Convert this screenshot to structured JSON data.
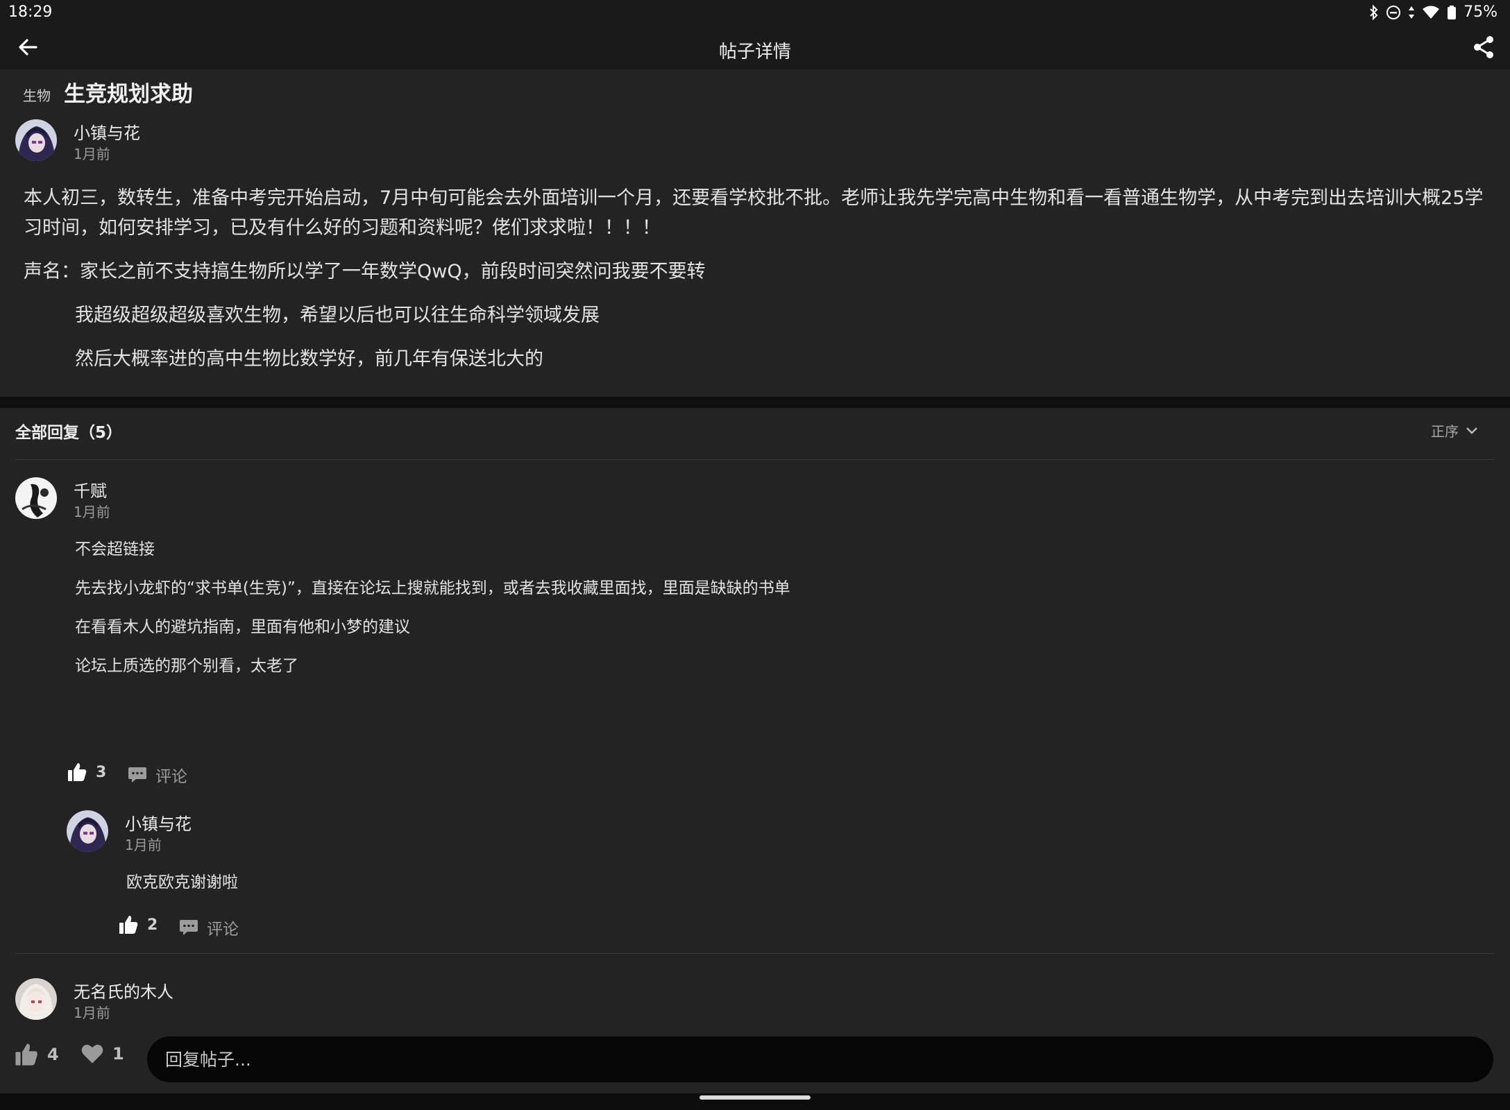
{
  "status": {
    "time": "18:29",
    "battery": "75%"
  },
  "topbar": {
    "title": "帖子详情"
  },
  "post": {
    "tag": "生物",
    "title": "生竞规划求助",
    "author": "小镇与花",
    "time": "1月前",
    "paragraphs": [
      "本人初三，数转生，准备中考完开始启动，7月中旬可能会去外面培训一个月，还要看学校批不批。老师让我先学完高中生物和看一看普通生物学，从中考完到出去培训大概25学习时间，如何安排学习，已及有什么好的习题和资料呢？佬们求求啦！！！！",
      "声名：家长之前不支持搞生物所以学了一年数学QwQ，前段时间突然问我要不要转",
      "我超级超级超级喜欢生物，希望以后也可以往生命科学领域发展",
      "然后大概率进的高中生物比数学好，前几年有保送北大的"
    ]
  },
  "replies": {
    "header": "全部回复（5）",
    "sort_label": "正序",
    "items": [
      {
        "author": "千赋",
        "time": "1月前",
        "lines": [
          "不会超链接",
          "先去找小龙虾的“求书单(生竞)”，直接在论坛上搜就能找到，或者去我收藏里面找，里面是缺缺的书单",
          "在看看木人的避坑指南，里面有他和小梦的建议",
          "论坛上质选的那个别看，太老了"
        ],
        "likes": "3",
        "comment_label": "评论",
        "sub": {
          "author": "小镇与花",
          "time": "1月前",
          "text": "欧克欧克谢谢啦",
          "likes": "2",
          "comment_label": "评论"
        }
      },
      {
        "author": "无名氏的木人",
        "time": "1月前"
      }
    ]
  },
  "bottom": {
    "likes": "4",
    "favorites": "1",
    "reply_placeholder": "回复帖子..."
  }
}
